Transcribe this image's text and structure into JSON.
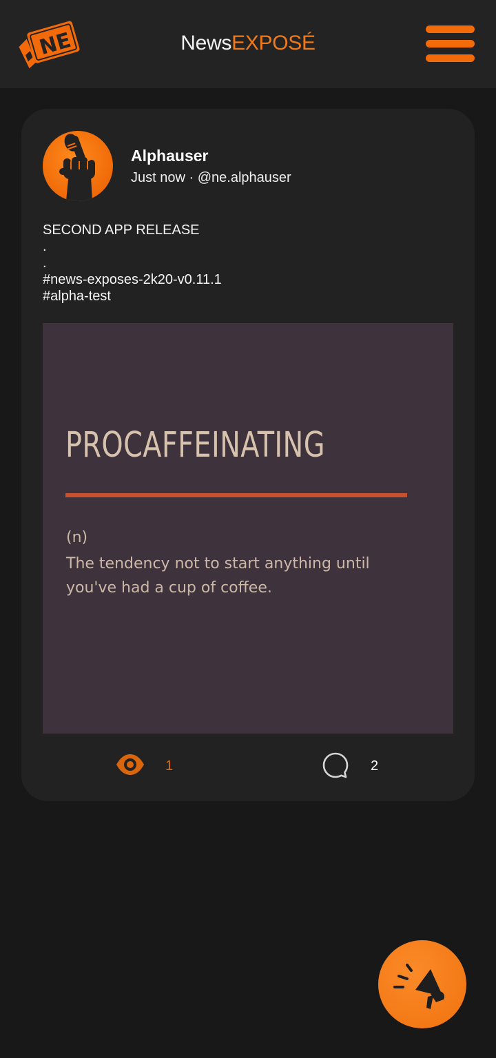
{
  "header": {
    "logo_letters": "NE",
    "title_part1": "News",
    "title_part2": "EXPOSÉ",
    "menu_icon": "hamburger-menu-icon"
  },
  "post": {
    "author": "Alphauser",
    "timestamp": "Just now",
    "separator": "·",
    "handle": "@ne.alphauser",
    "avatar_icon": "raised-fist-with-microphone-icon",
    "lines": [
      "SECOND APP RELEASE",
      ".",
      ".",
      "#news-exposes-2k20-v0.11.1",
      "#alpha-test"
    ],
    "image": {
      "heading": "PROCAFFEINATING",
      "part_of_speech": "(n)",
      "definition": "The tendency not to start anything until you've had a cup of coffee."
    },
    "views": "1",
    "comments": "2",
    "views_icon": "eye-icon",
    "comments_icon": "speech-bubble-icon"
  },
  "fab": {
    "icon": "megaphone-icon"
  },
  "colors": {
    "accent": "#f26a0a",
    "background": "#181818",
    "card": "#222222",
    "image_bg": "#3e333c"
  }
}
